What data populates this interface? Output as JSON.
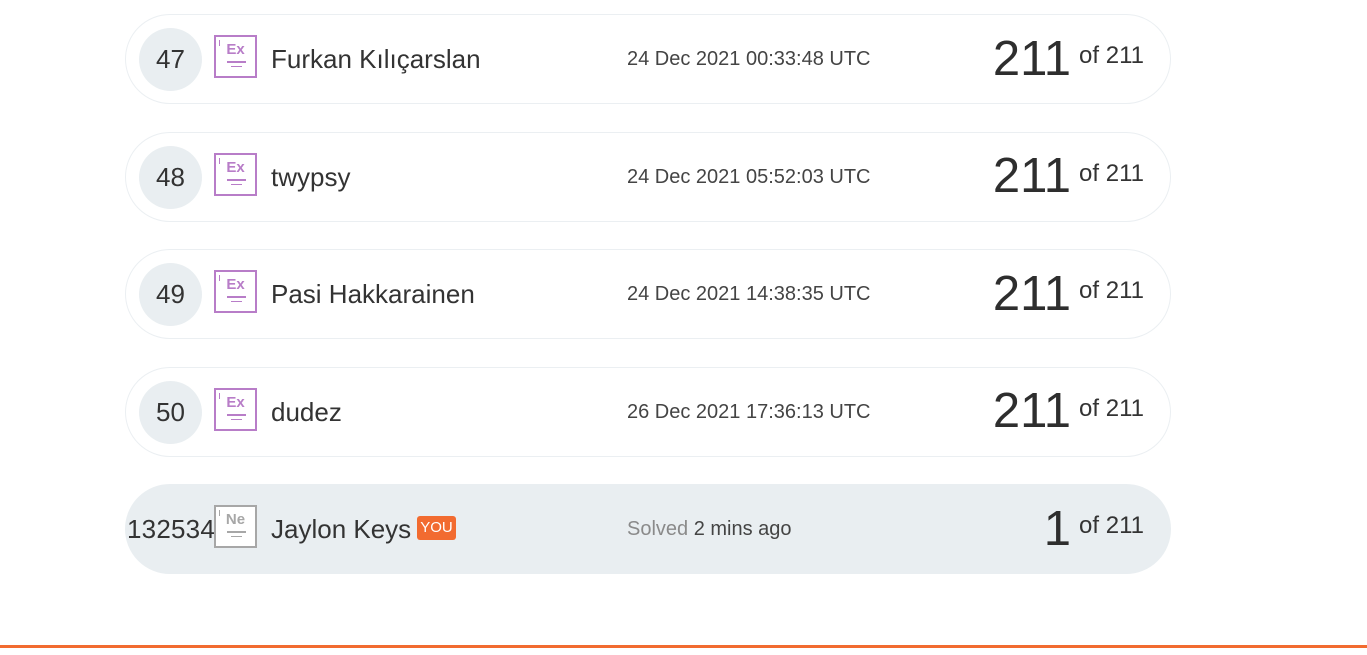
{
  "leaderboard": {
    "rows": [
      {
        "rank": "47",
        "badge": "Ex",
        "name": "Furkan Kılıçarslan",
        "date": "24 Dec 2021 00:33:48 UTC",
        "solved": "211",
        "of": "of 211"
      },
      {
        "rank": "48",
        "badge": "Ex",
        "name": "twypsy",
        "date": "24 Dec 2021 05:52:03 UTC",
        "solved": "211",
        "of": "of 211"
      },
      {
        "rank": "49",
        "badge": "Ex",
        "name": "Pasi Hakkarainen",
        "date": "24 Dec 2021 14:38:35 UTC",
        "solved": "211",
        "of": "of 211"
      },
      {
        "rank": "50",
        "badge": "Ex",
        "name": "dudez",
        "date": "26 Dec 2021 17:36:13 UTC",
        "solved": "211",
        "of": "of 211"
      }
    ],
    "current_user": {
      "rank": "132534",
      "badge": "Ne",
      "name": "Jaylon Keys",
      "you_label": "YOU",
      "solved_prefix": "Solved",
      "solved_when": "2 mins ago",
      "solved": "1",
      "of": "of 211"
    }
  },
  "colors": {
    "accent": "#f26b30",
    "expert_badge": "#b87dc8",
    "newbie_badge": "#a7a7a7",
    "highlight_row": "#e9eef1"
  }
}
